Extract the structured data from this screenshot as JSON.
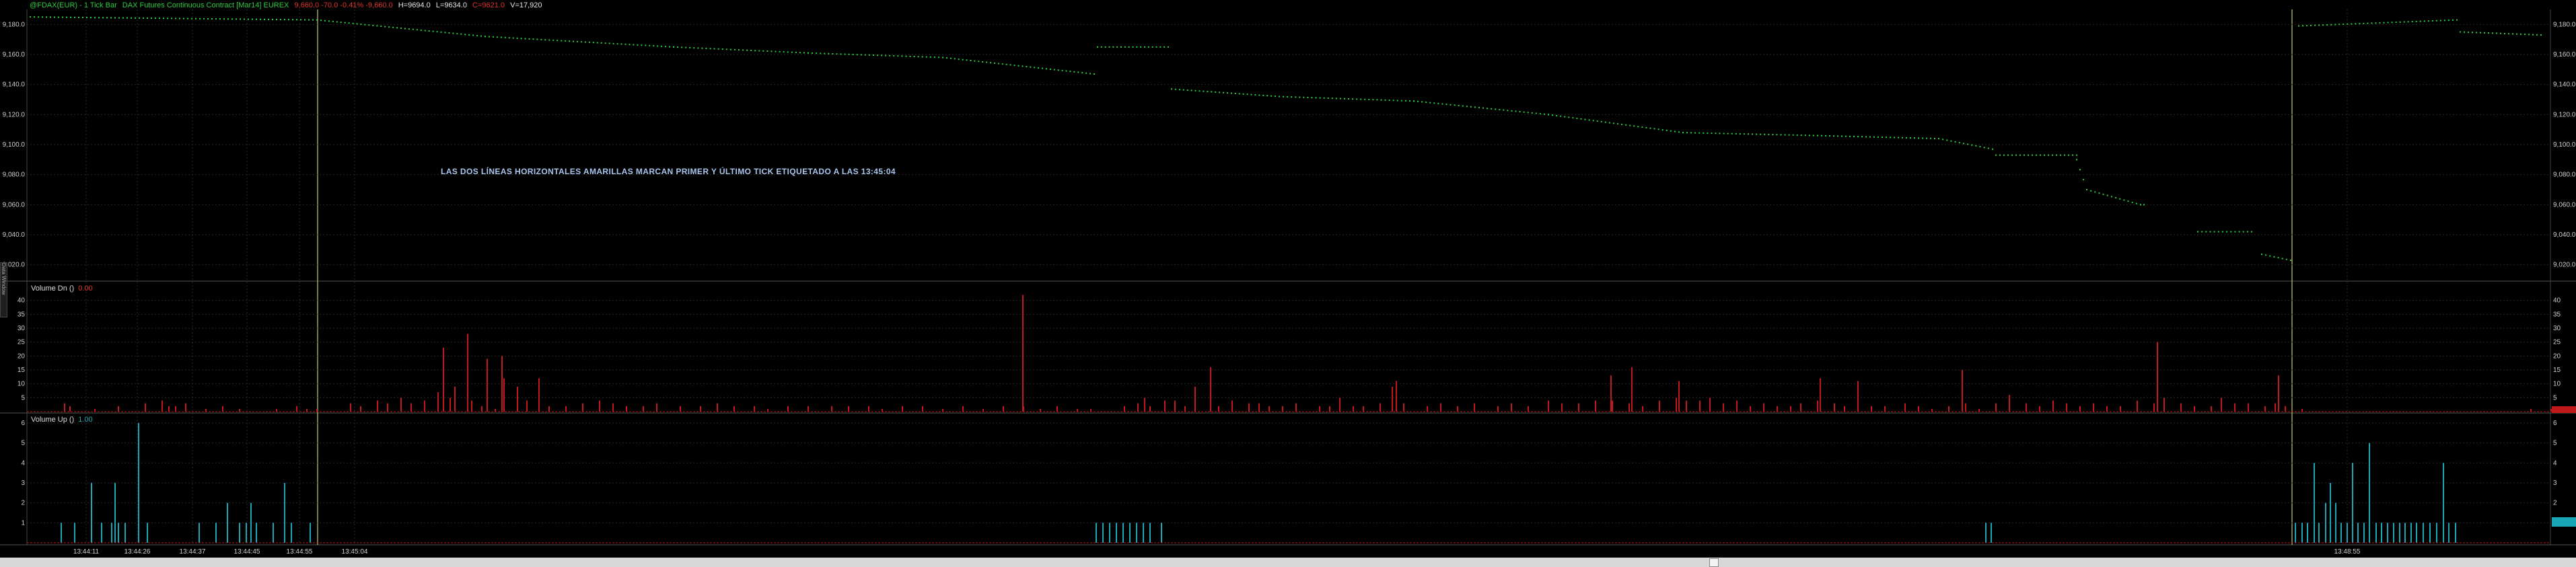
{
  "header": {
    "symbol": "@FDAX(EUR) - 1 Tick Bar",
    "description": "DAX Futures Continuous Contract [Mar14] EUREX",
    "change": "9,660.0 -70.0 -0.41% -9,660.0",
    "high": "H=9694.0",
    "low": "L=9634.0",
    "last": "C=9621.0",
    "volume": "V=17,920"
  },
  "annotation": "LAS DOS LÍNEAS HORIZONTALES AMARILLAS MARCAN PRIMER Y ÚLTIMO TICK ETIQUETADO A LAS 13:45:04",
  "side_tab": "Data Window",
  "colors": {
    "price_dots": "#2ecc40",
    "volume_dn": "#c0181b",
    "volume_up": "#1aa6b4",
    "marker_line": "#a6a35a",
    "baseline": "#c0181b",
    "grid": "#2a2a2a"
  },
  "panes": {
    "volume_dn": {
      "label": "Volume Dn ()",
      "value": "0.00"
    },
    "volume_up": {
      "label": "Volume Up ()",
      "value": "1.00"
    }
  },
  "chart_data": [
    {
      "type": "scatter",
      "pane": "price",
      "ylim": [
        9010,
        9190
      ],
      "yticks": [
        9020,
        9040,
        9060,
        9080,
        9100,
        9120,
        9140,
        9160,
        9180
      ],
      "ytick_labels": [
        "9,020.0",
        "9,040.0",
        "9,060.0",
        "9,080.0",
        "9,100.0",
        "9,120.0",
        "9,140.0",
        "9,160.0",
        "9,180.0"
      ],
      "x_count": 3828,
      "segments": [
        {
          "x": [
            44,
            470,
            720,
            1000,
            1200,
            1400,
            1625
          ],
          "y": [
            9185,
            9183,
            9172,
            9165,
            9161,
            9158,
            9147
          ]
        },
        {
          "x": [
            1630,
            1735
          ],
          "y": [
            9165,
            9165
          ]
        },
        {
          "x": [
            1740,
            1900,
            2100,
            2300,
            2500,
            2700,
            2880,
            2960
          ],
          "y": [
            9137,
            9132,
            9129,
            9120,
            9108,
            9106,
            9104,
            9097
          ]
        },
        {
          "x": [
            2965,
            3085
          ],
          "y": [
            9093,
            9093
          ]
        },
        {
          "x": [
            3085,
            3100,
            3180,
            3185
          ],
          "y": [
            9090,
            9070,
            9060,
            9060
          ]
        },
        {
          "x": [
            3265,
            3345
          ],
          "y": [
            9042,
            9042
          ]
        },
        {
          "x": [
            3360,
            3403
          ],
          "y": [
            9027,
            9023
          ]
        },
        {
          "x": [
            3415,
            3650
          ],
          "y": [
            9179,
            9183
          ]
        },
        {
          "x": [
            3655,
            3775
          ],
          "y": [
            9175,
            9173
          ]
        }
      ]
    },
    {
      "type": "bar",
      "pane": "volume_dn",
      "ylim": [
        0,
        45
      ],
      "yticks": [
        5,
        10,
        15,
        20,
        25,
        30,
        35,
        40
      ],
      "bars": [
        [
          95,
          3
        ],
        [
          103,
          2
        ],
        [
          140,
          1
        ],
        [
          175,
          2
        ],
        [
          215,
          3
        ],
        [
          240,
          4
        ],
        [
          250,
          2
        ],
        [
          260,
          2
        ],
        [
          275,
          3
        ],
        [
          305,
          1
        ],
        [
          330,
          2
        ],
        [
          355,
          1
        ],
        [
          410,
          1
        ],
        [
          440,
          2
        ],
        [
          455,
          1
        ],
        [
          470,
          1
        ],
        [
          520,
          3
        ],
        [
          535,
          2
        ],
        [
          560,
          4
        ],
        [
          575,
          3
        ],
        [
          595,
          5
        ],
        [
          610,
          3
        ],
        [
          630,
          4
        ],
        [
          650,
          7
        ],
        [
          668,
          5
        ],
        [
          675,
          9
        ],
        [
          700,
          4
        ],
        [
          715,
          2
        ],
        [
          735,
          1
        ],
        [
          748,
          12
        ],
        [
          768,
          9
        ],
        [
          782,
          4
        ],
        [
          800,
          12
        ],
        [
          815,
          2
        ],
        [
          840,
          2
        ],
        [
          865,
          3
        ],
        [
          890,
          4
        ],
        [
          910,
          3
        ],
        [
          930,
          2
        ],
        [
          955,
          2
        ],
        [
          975,
          3
        ],
        [
          1010,
          2
        ],
        [
          1040,
          2
        ],
        [
          1065,
          3
        ],
        [
          1090,
          2
        ],
        [
          1120,
          2
        ],
        [
          1140,
          1
        ],
        [
          1170,
          2
        ],
        [
          1200,
          2
        ],
        [
          1235,
          2
        ],
        [
          1260,
          2
        ],
        [
          1290,
          2
        ],
        [
          1310,
          1
        ],
        [
          1340,
          2
        ],
        [
          1370,
          2
        ],
        [
          1400,
          1
        ],
        [
          1430,
          2
        ],
        [
          1460,
          1
        ],
        [
          1490,
          2
        ],
        [
          1520,
          2
        ],
        [
          1545,
          1
        ],
        [
          1570,
          2
        ],
        [
          1600,
          1
        ],
        [
          1620,
          1
        ],
        [
          1670,
          2
        ],
        [
          1690,
          3
        ],
        [
          1700,
          5
        ],
        [
          1708,
          2
        ],
        [
          1730,
          4
        ],
        [
          1745,
          4
        ],
        [
          1760,
          2
        ],
        [
          1810,
          2
        ],
        [
          1830,
          4
        ],
        [
          1855,
          3
        ],
        [
          1870,
          3
        ],
        [
          1885,
          2
        ],
        [
          1905,
          2
        ],
        [
          1925,
          3
        ],
        [
          1960,
          2
        ],
        [
          1975,
          2
        ],
        [
          1990,
          5
        ],
        [
          2010,
          2
        ],
        [
          2025,
          2
        ],
        [
          2050,
          3
        ],
        [
          2068,
          9
        ],
        [
          2085,
          3
        ],
        [
          2120,
          2
        ],
        [
          2140,
          3
        ],
        [
          2165,
          2
        ],
        [
          2190,
          3
        ],
        [
          2225,
          2
        ],
        [
          2245,
          3
        ],
        [
          2270,
          2
        ],
        [
          2300,
          4
        ],
        [
          2320,
          3
        ],
        [
          2345,
          3
        ],
        [
          2370,
          4
        ],
        [
          2395,
          4
        ],
        [
          2420,
          3
        ],
        [
          2440,
          2
        ],
        [
          2465,
          4
        ],
        [
          2490,
          5
        ],
        [
          2505,
          4
        ],
        [
          2525,
          4
        ],
        [
          2540,
          5
        ],
        [
          2560,
          3
        ],
        [
          2580,
          4
        ],
        [
          2600,
          2
        ],
        [
          2620,
          3
        ],
        [
          2640,
          2
        ],
        [
          2660,
          2
        ],
        [
          2675,
          3
        ],
        [
          2700,
          4
        ],
        [
          2725,
          3
        ],
        [
          2740,
          2
        ],
        [
          2760,
          2
        ],
        [
          2780,
          2
        ],
        [
          2800,
          2
        ],
        [
          2830,
          3
        ],
        [
          2850,
          2
        ],
        [
          2870,
          1
        ],
        [
          2895,
          2
        ],
        [
          2920,
          3
        ],
        [
          2940,
          1
        ],
        [
          2965,
          3
        ],
        [
          2985,
          6
        ],
        [
          3010,
          3
        ],
        [
          3030,
          2
        ],
        [
          3050,
          4
        ],
        [
          3070,
          3
        ],
        [
          3090,
          2
        ],
        [
          3110,
          3
        ],
        [
          3130,
          2
        ],
        [
          3150,
          2
        ],
        [
          3175,
          4
        ],
        [
          3200,
          3
        ],
        [
          3215,
          5
        ],
        [
          3240,
          3
        ],
        [
          3260,
          2
        ],
        [
          3285,
          2
        ],
        [
          3300,
          5
        ],
        [
          3320,
          3
        ],
        [
          3340,
          3
        ],
        [
          3365,
          2
        ],
        [
          3380,
          3
        ],
        [
          3395,
          2
        ],
        [
          3420,
          1
        ],
        [
          3760,
          1
        ],
        [
          3790,
          1
        ],
        [
          3810,
          1
        ]
      ],
      "tall_bars": [
        [
          658,
          23
        ],
        [
          694,
          28
        ],
        [
          723,
          19
        ],
        [
          745,
          20
        ],
        [
          1519,
          42
        ],
        [
          1775,
          9
        ],
        [
          1798,
          16
        ],
        [
          2074,
          11
        ],
        [
          2393,
          13
        ],
        [
          2424,
          16
        ],
        [
          2494,
          11
        ],
        [
          2704,
          12
        ],
        [
          2760,
          11
        ],
        [
          2915,
          15
        ],
        [
          3205,
          25
        ],
        [
          3385,
          13
        ]
      ]
    },
    {
      "type": "bar",
      "pane": "volume_up",
      "ylim": [
        0,
        6.2
      ],
      "yticks": [
        1,
        2,
        3,
        4,
        5,
        6
      ],
      "bars": [
        [
          90,
          1
        ],
        [
          110,
          1
        ],
        [
          135,
          3
        ],
        [
          150,
          1
        ],
        [
          165,
          1
        ],
        [
          170,
          3
        ],
        [
          175,
          1
        ],
        [
          185,
          1
        ],
        [
          205,
          6
        ],
        [
          218,
          1
        ],
        [
          295,
          1
        ],
        [
          320,
          1
        ],
        [
          337,
          2
        ],
        [
          355,
          1
        ],
        [
          365,
          1
        ],
        [
          372,
          2
        ],
        [
          380,
          1
        ],
        [
          405,
          1
        ],
        [
          422,
          3
        ],
        [
          432,
          1
        ],
        [
          460,
          1
        ],
        [
          1628,
          1
        ],
        [
          1638,
          1
        ],
        [
          1648,
          1
        ],
        [
          1658,
          1
        ],
        [
          1668,
          1
        ],
        [
          1678,
          1
        ],
        [
          1688,
          1
        ],
        [
          1698,
          1
        ],
        [
          1708,
          1
        ],
        [
          1725,
          1
        ],
        [
          2950,
          1
        ],
        [
          2958,
          1
        ],
        [
          3410,
          1
        ],
        [
          3420,
          1
        ],
        [
          3428,
          1
        ],
        [
          3438,
          4
        ],
        [
          3445,
          1
        ],
        [
          3455,
          2
        ],
        [
          3462,
          3
        ],
        [
          3470,
          2
        ],
        [
          3478,
          1
        ],
        [
          3487,
          1
        ],
        [
          3495,
          4
        ],
        [
          3503,
          1
        ],
        [
          3512,
          1
        ],
        [
          3520,
          5
        ],
        [
          3530,
          1
        ],
        [
          3538,
          1
        ],
        [
          3547,
          1
        ],
        [
          3556,
          1
        ],
        [
          3565,
          1
        ],
        [
          3573,
          1
        ],
        [
          3582,
          1
        ],
        [
          3590,
          1
        ],
        [
          3600,
          1
        ],
        [
          3610,
          1
        ],
        [
          3620,
          1
        ],
        [
          3630,
          4
        ],
        [
          3638,
          1
        ],
        [
          3648,
          1
        ]
      ]
    }
  ],
  "time_axis": {
    "labels": [
      "13:44:11",
      "13:44:26",
      "13:44:37",
      "13:44:45",
      "13:44:55",
      "13:45:04",
      "13:48:55"
    ],
    "positions": [
      128,
      204,
      286,
      367,
      445,
      527,
      3488
    ]
  },
  "marker_lines": [
    472,
    3406
  ]
}
